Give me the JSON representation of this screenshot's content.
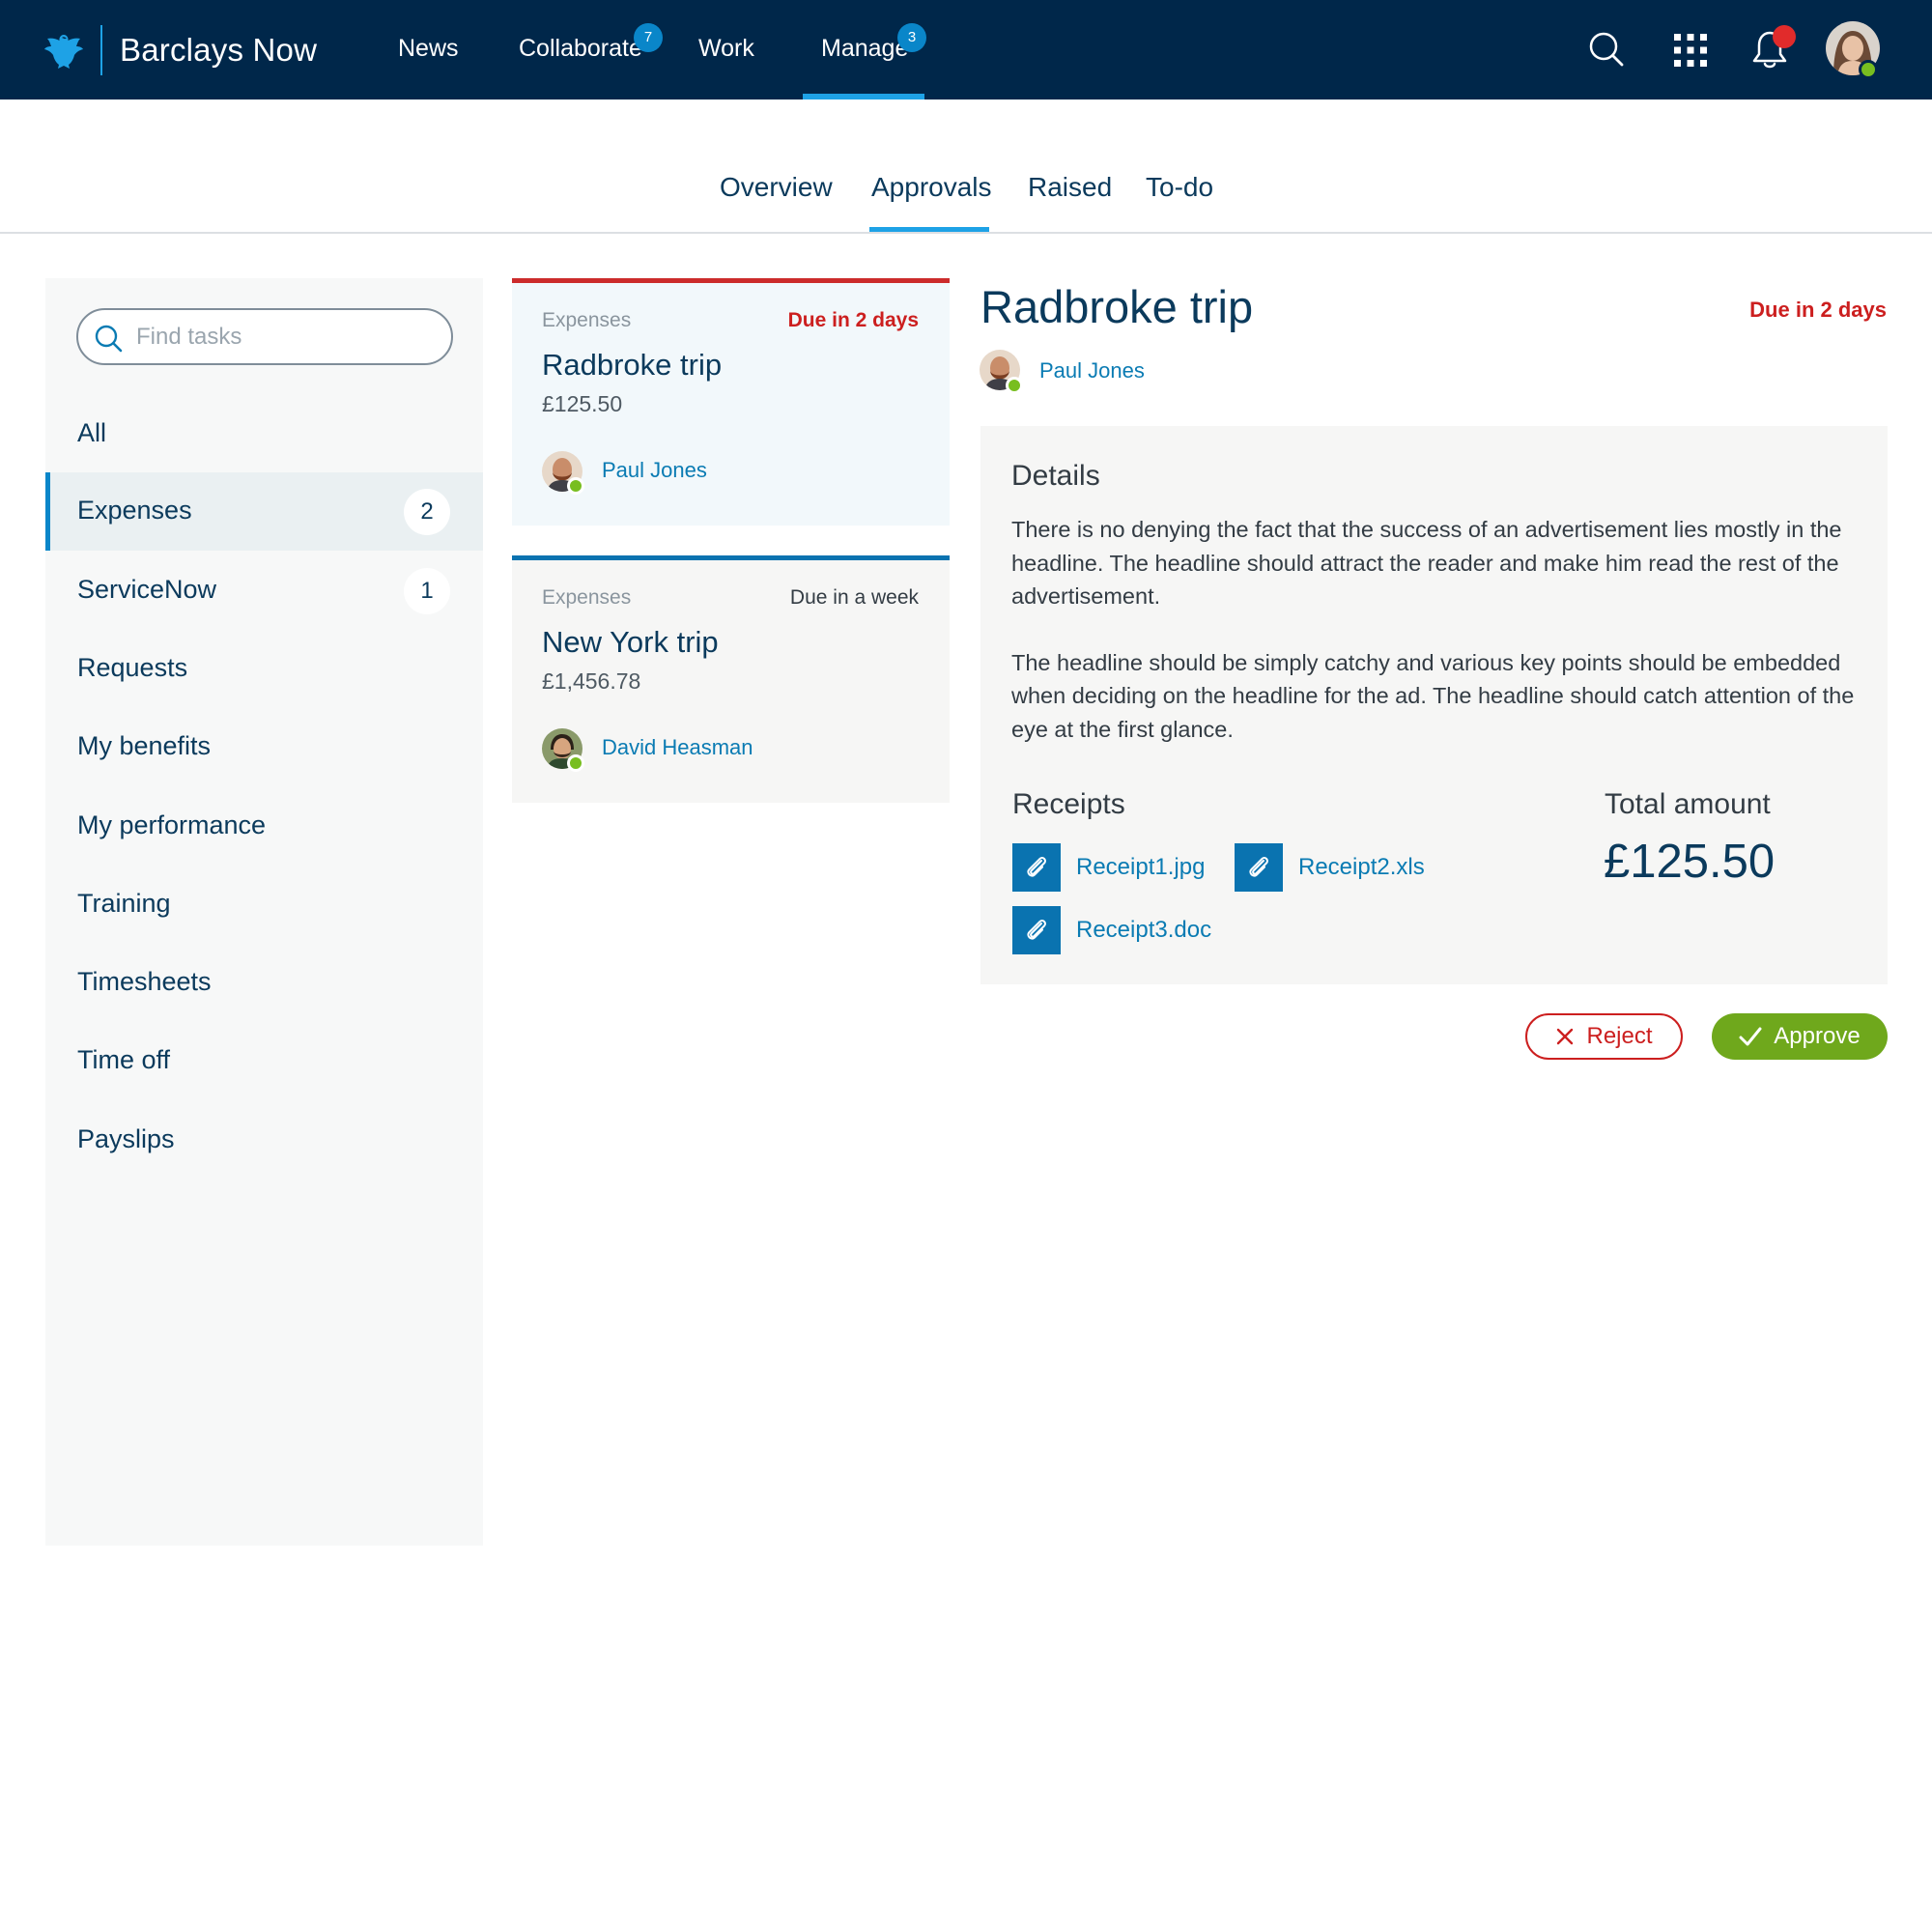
{
  "header": {
    "app_name": "Barclays Now",
    "nav": [
      {
        "label": "News"
      },
      {
        "label": "Collaborate",
        "badge": "7"
      },
      {
        "label": "Work"
      },
      {
        "label": "Manage",
        "badge": "3",
        "active": true
      }
    ],
    "icons": [
      "search-icon",
      "apps-grid-icon",
      "bell-icon",
      "user-avatar"
    ],
    "colors": {
      "bar": "#00274a",
      "accent": "#1ea2e6",
      "alert": "#e12b2b",
      "online": "#78be20"
    }
  },
  "tabs": [
    {
      "label": "Overview"
    },
    {
      "label": "Approvals",
      "active": true
    },
    {
      "label": "Raised"
    },
    {
      "label": "To-do"
    }
  ],
  "sidebar": {
    "search_placeholder": "Find tasks",
    "items": [
      {
        "label": "All"
      },
      {
        "label": "Expenses",
        "count": "2",
        "active": true
      },
      {
        "label": "ServiceNow",
        "count": "1"
      },
      {
        "label": "Requests"
      },
      {
        "label": "My benefits"
      },
      {
        "label": "My performance"
      },
      {
        "label": "Training"
      },
      {
        "label": "Timesheets"
      },
      {
        "label": "Time off"
      },
      {
        "label": "Payslips"
      }
    ]
  },
  "tasks": [
    {
      "category": "Expenses",
      "due": "Due in 2 days",
      "due_urgent": true,
      "title": "Radbroke trip",
      "amount": "£125.50",
      "person": "Paul Jones",
      "selected": true
    },
    {
      "category": "Expenses",
      "due": "Due in a week",
      "due_urgent": false,
      "title": "New York trip",
      "amount": "£1,456.78",
      "person": "David Heasman",
      "selected": false
    }
  ],
  "detail": {
    "title": "Radbroke trip",
    "due": "Due in 2 days",
    "person": "Paul Jones",
    "details_heading": "Details",
    "paragraphs": [
      "There is no denying the fact that the success of an advertisement lies mostly in the headline. The headline should attract the reader and make him read the rest of the advertisement.",
      "The headline should be simply catchy and various key points should be embedded when deciding on the headline for the ad. The headline should catch attention of the eye at the first glance."
    ],
    "receipts_heading": "Receipts",
    "receipts": [
      {
        "name": "Receipt1.jpg",
        "icon": "paperclip-icon"
      },
      {
        "name": "Receipt2.xls",
        "icon": "paperclip-icon"
      },
      {
        "name": "Receipt3.doc",
        "icon": "paperclip-icon"
      }
    ],
    "total_label": "Total amount",
    "total_value": "£125.50"
  },
  "actions": {
    "reject_label": "Reject",
    "approve_label": "Approve",
    "colors": {
      "reject": "#cc1f1f",
      "approve": "#6fa81c"
    }
  }
}
